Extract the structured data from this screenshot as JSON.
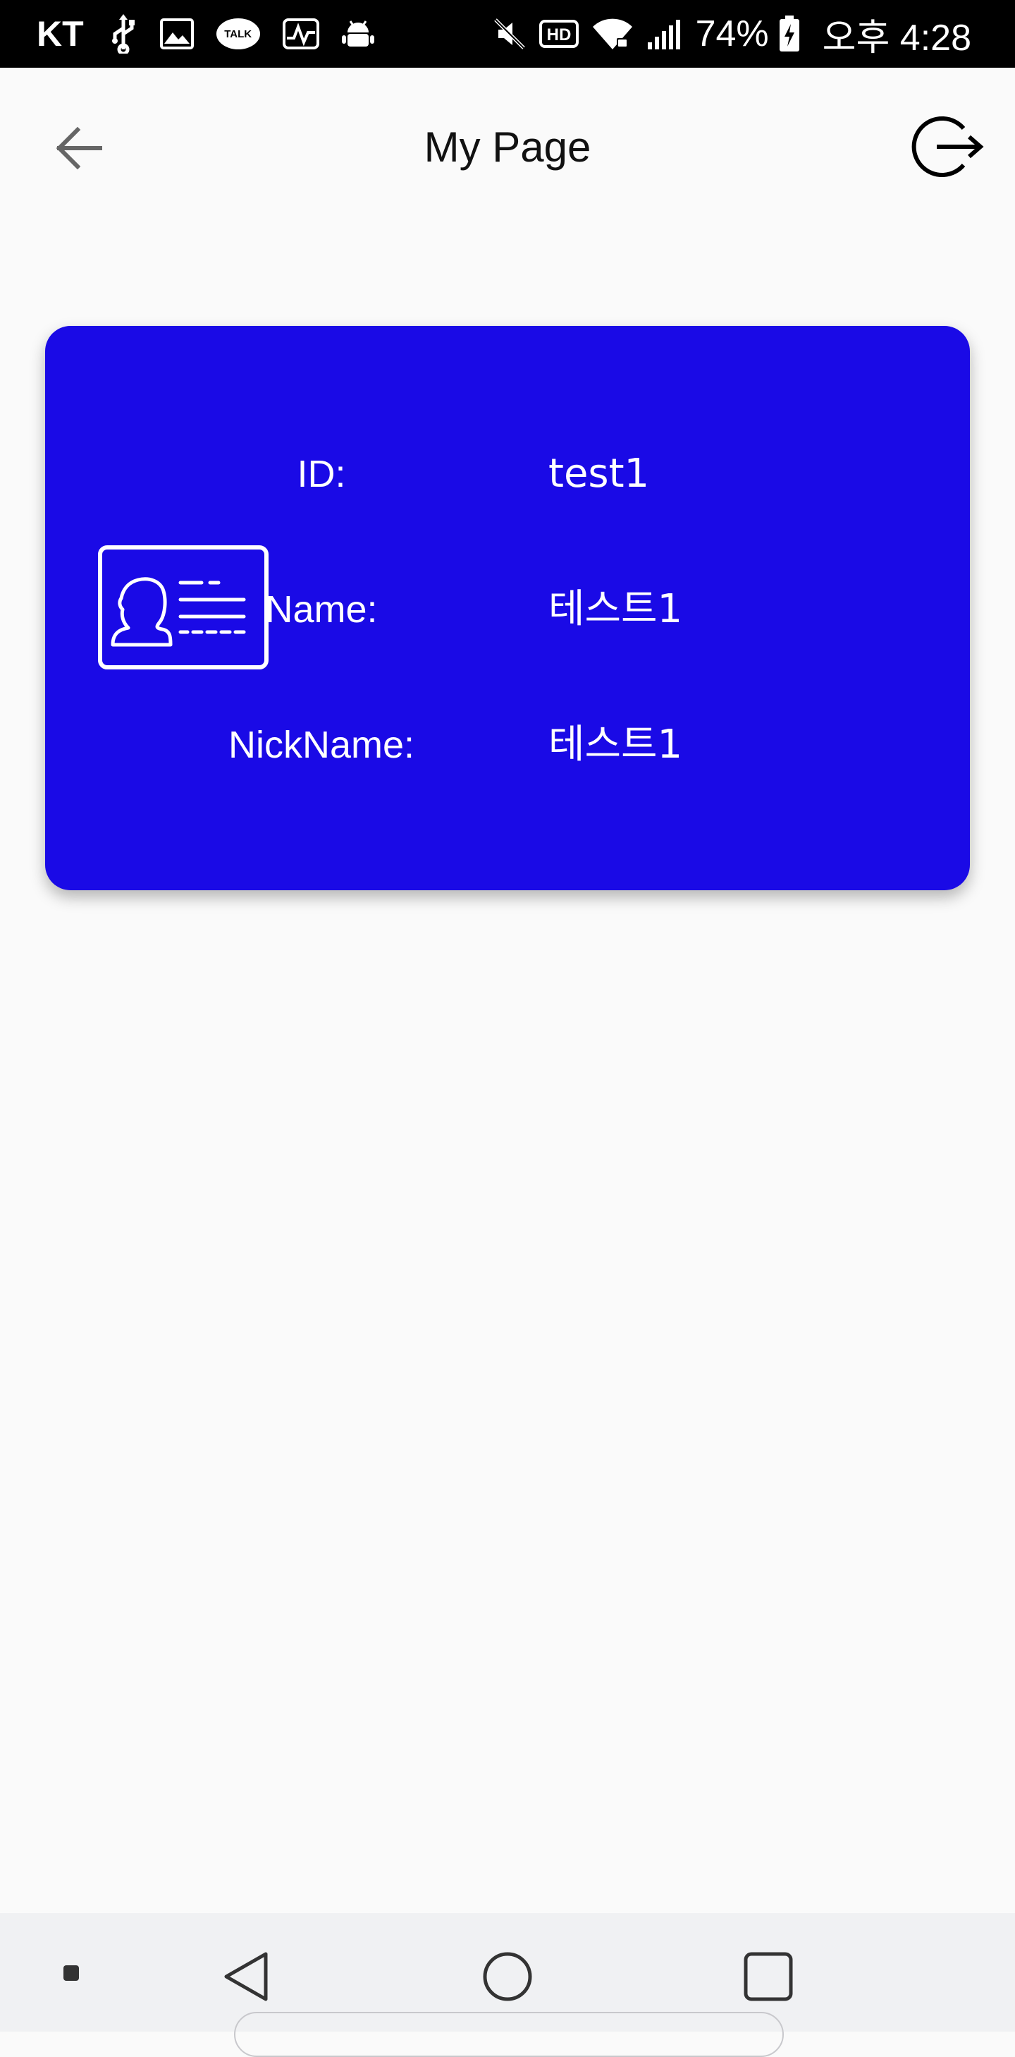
{
  "status_bar": {
    "carrier": "KT",
    "talk_badge": "TALK",
    "battery_percent": "74%",
    "time": "오후 4:28",
    "icons": [
      "usb-icon",
      "image-icon",
      "kakaotalk-icon",
      "activity-icon",
      "android-debug-icon",
      "mute-icon",
      "hd-icon",
      "wifi-icon",
      "signal-icon",
      "battery-charging-icon"
    ]
  },
  "app_bar": {
    "title": "My Page",
    "back_icon": "arrow-left-icon",
    "logout_icon": "logout-icon"
  },
  "profile": {
    "card_color": "#1a0ae6",
    "card_icon": "id-card-icon",
    "fields": [
      {
        "label": "ID:",
        "value": "test1"
      },
      {
        "label": "Name:",
        "value": "테스트1"
      },
      {
        "label": "NickName:",
        "value": "테스트1"
      }
    ]
  },
  "nav_bar": {
    "icons": [
      "dot-icon",
      "triangle-back-icon",
      "circle-home-icon",
      "square-recent-icon"
    ]
  }
}
